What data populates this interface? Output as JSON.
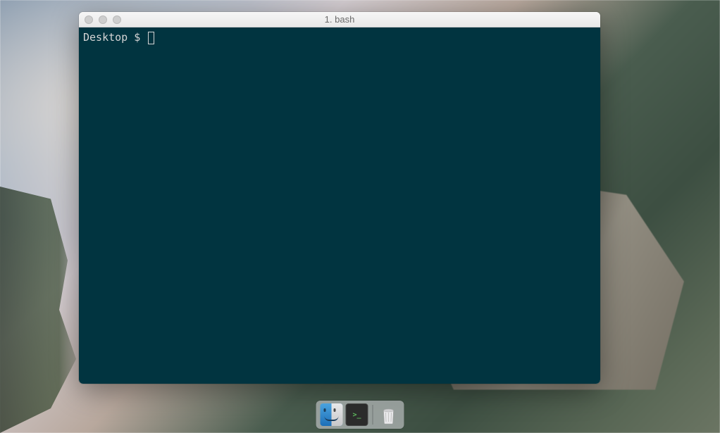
{
  "window": {
    "title": "1. bash"
  },
  "terminal": {
    "prompt": "Desktop $ ",
    "icon_label": ">_"
  },
  "dock": {
    "items": {
      "finder": "finder",
      "terminal": "terminal",
      "trash": "trash"
    }
  }
}
